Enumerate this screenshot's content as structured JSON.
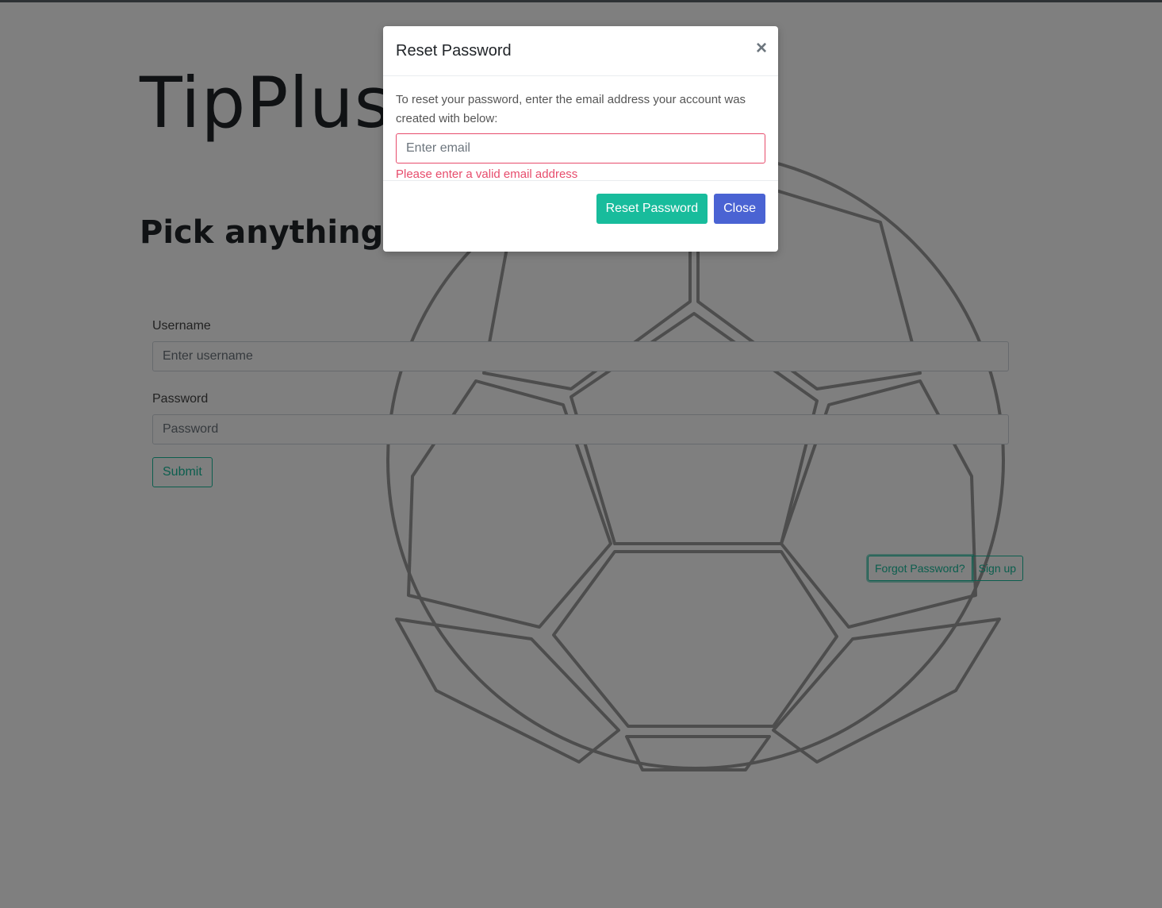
{
  "page": {
    "title": "TipPlus",
    "tagline": "Pick anything, anytime"
  },
  "login_form": {
    "username_label": "Username",
    "username_placeholder": "Enter username",
    "password_label": "Password",
    "password_placeholder": "Password",
    "submit_label": "Submit"
  },
  "links": {
    "forgot_password": "Forgot Password?",
    "sign_up": "Sign up"
  },
  "modal": {
    "title": "Reset Password",
    "close_symbol": "×",
    "description": "To reset your password, enter the email address your account was created with below:",
    "email_placeholder": "Enter email",
    "email_value": "",
    "error_message": "Please enter a valid email address",
    "reset_button": "Reset Password",
    "close_button": "Close"
  },
  "colors": {
    "accent": "#18bc9c",
    "primary": "#4a63d3",
    "danger": "#e74c6c",
    "backdrop": "rgba(0,0,0,0.5)"
  },
  "icons": {
    "background": "soccer-ball-icon",
    "close": "close-icon"
  }
}
